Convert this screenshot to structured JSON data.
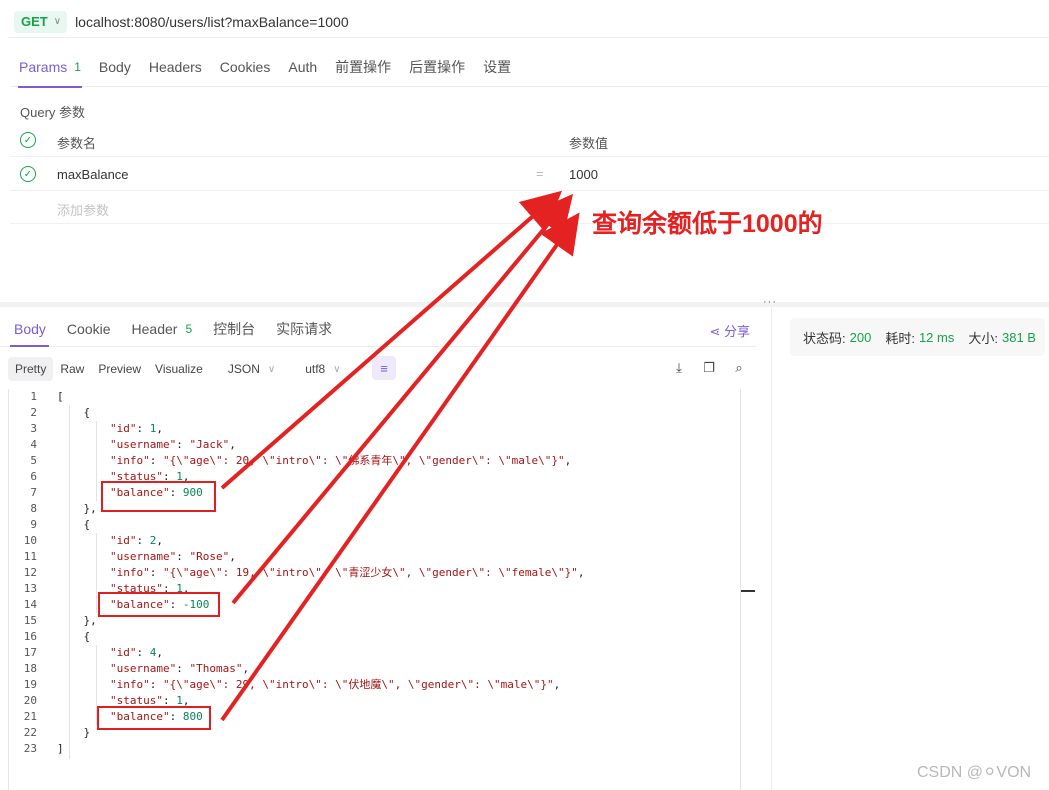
{
  "request": {
    "method": "GET",
    "url": "localhost:8080/users/list?maxBalance=1000",
    "tabs": [
      {
        "label": "Params",
        "badge": "1"
      },
      {
        "label": "Body"
      },
      {
        "label": "Headers"
      },
      {
        "label": "Cookies"
      },
      {
        "label": "Auth"
      },
      {
        "label": "前置操作"
      },
      {
        "label": "后置操作"
      },
      {
        "label": "设置"
      }
    ],
    "query_title": "Query 参数",
    "columns": {
      "name": "参数名",
      "value": "参数值"
    },
    "params": [
      {
        "key": "maxBalance",
        "value": "1000"
      }
    ],
    "add_placeholder": "添加参数",
    "eq": "="
  },
  "response": {
    "tabs": [
      {
        "label": "Body"
      },
      {
        "label": "Cookie"
      },
      {
        "label": "Header",
        "badge": "5"
      },
      {
        "label": "控制台"
      },
      {
        "label": "实际请求"
      }
    ],
    "share_label": "分享",
    "status": {
      "code_label": "状态码:",
      "code": "200",
      "time_label": "耗时:",
      "time": "12 ms",
      "size_label": "大小:",
      "size": "381 B"
    },
    "views": [
      "Pretty",
      "Raw",
      "Preview",
      "Visualize"
    ],
    "format": "JSON",
    "encoding": "utf8",
    "body_lines": [
      "[",
      "    {",
      "        \"id\": 1,",
      "        \"username\": \"Jack\",",
      "        \"info\": \"{\\\"age\\\": 20, \\\"intro\\\": \\\"佛系青年\\\", \\\"gender\\\": \\\"male\\\"}\",",
      "        \"status\": 1,",
      "        \"balance\": 900",
      "    },",
      "    {",
      "        \"id\": 2,",
      "        \"username\": \"Rose\",",
      "        \"info\": \"{\\\"age\\\": 19, \\\"intro\\\": \\\"青涩少女\\\", \\\"gender\\\": \\\"female\\\"}\",",
      "        \"status\": 1,",
      "        \"balance\": -100",
      "    },",
      "    {",
      "        \"id\": 4,",
      "        \"username\": \"Thomas\",",
      "        \"info\": \"{\\\"age\\\": 29, \\\"intro\\\": \\\"伏地魔\\\", \\\"gender\\\": \\\"male\\\"}\",",
      "        \"status\": 1,",
      "        \"balance\": 800",
      "    }",
      "]"
    ]
  },
  "annotation": {
    "text": "查询余额低于1000的",
    "color": "#e52222"
  },
  "watermark": "CSDN @⚪VON",
  "colors": {
    "accent": "#7b5cd6",
    "success": "#16a34a",
    "annotation": "#e52222"
  }
}
